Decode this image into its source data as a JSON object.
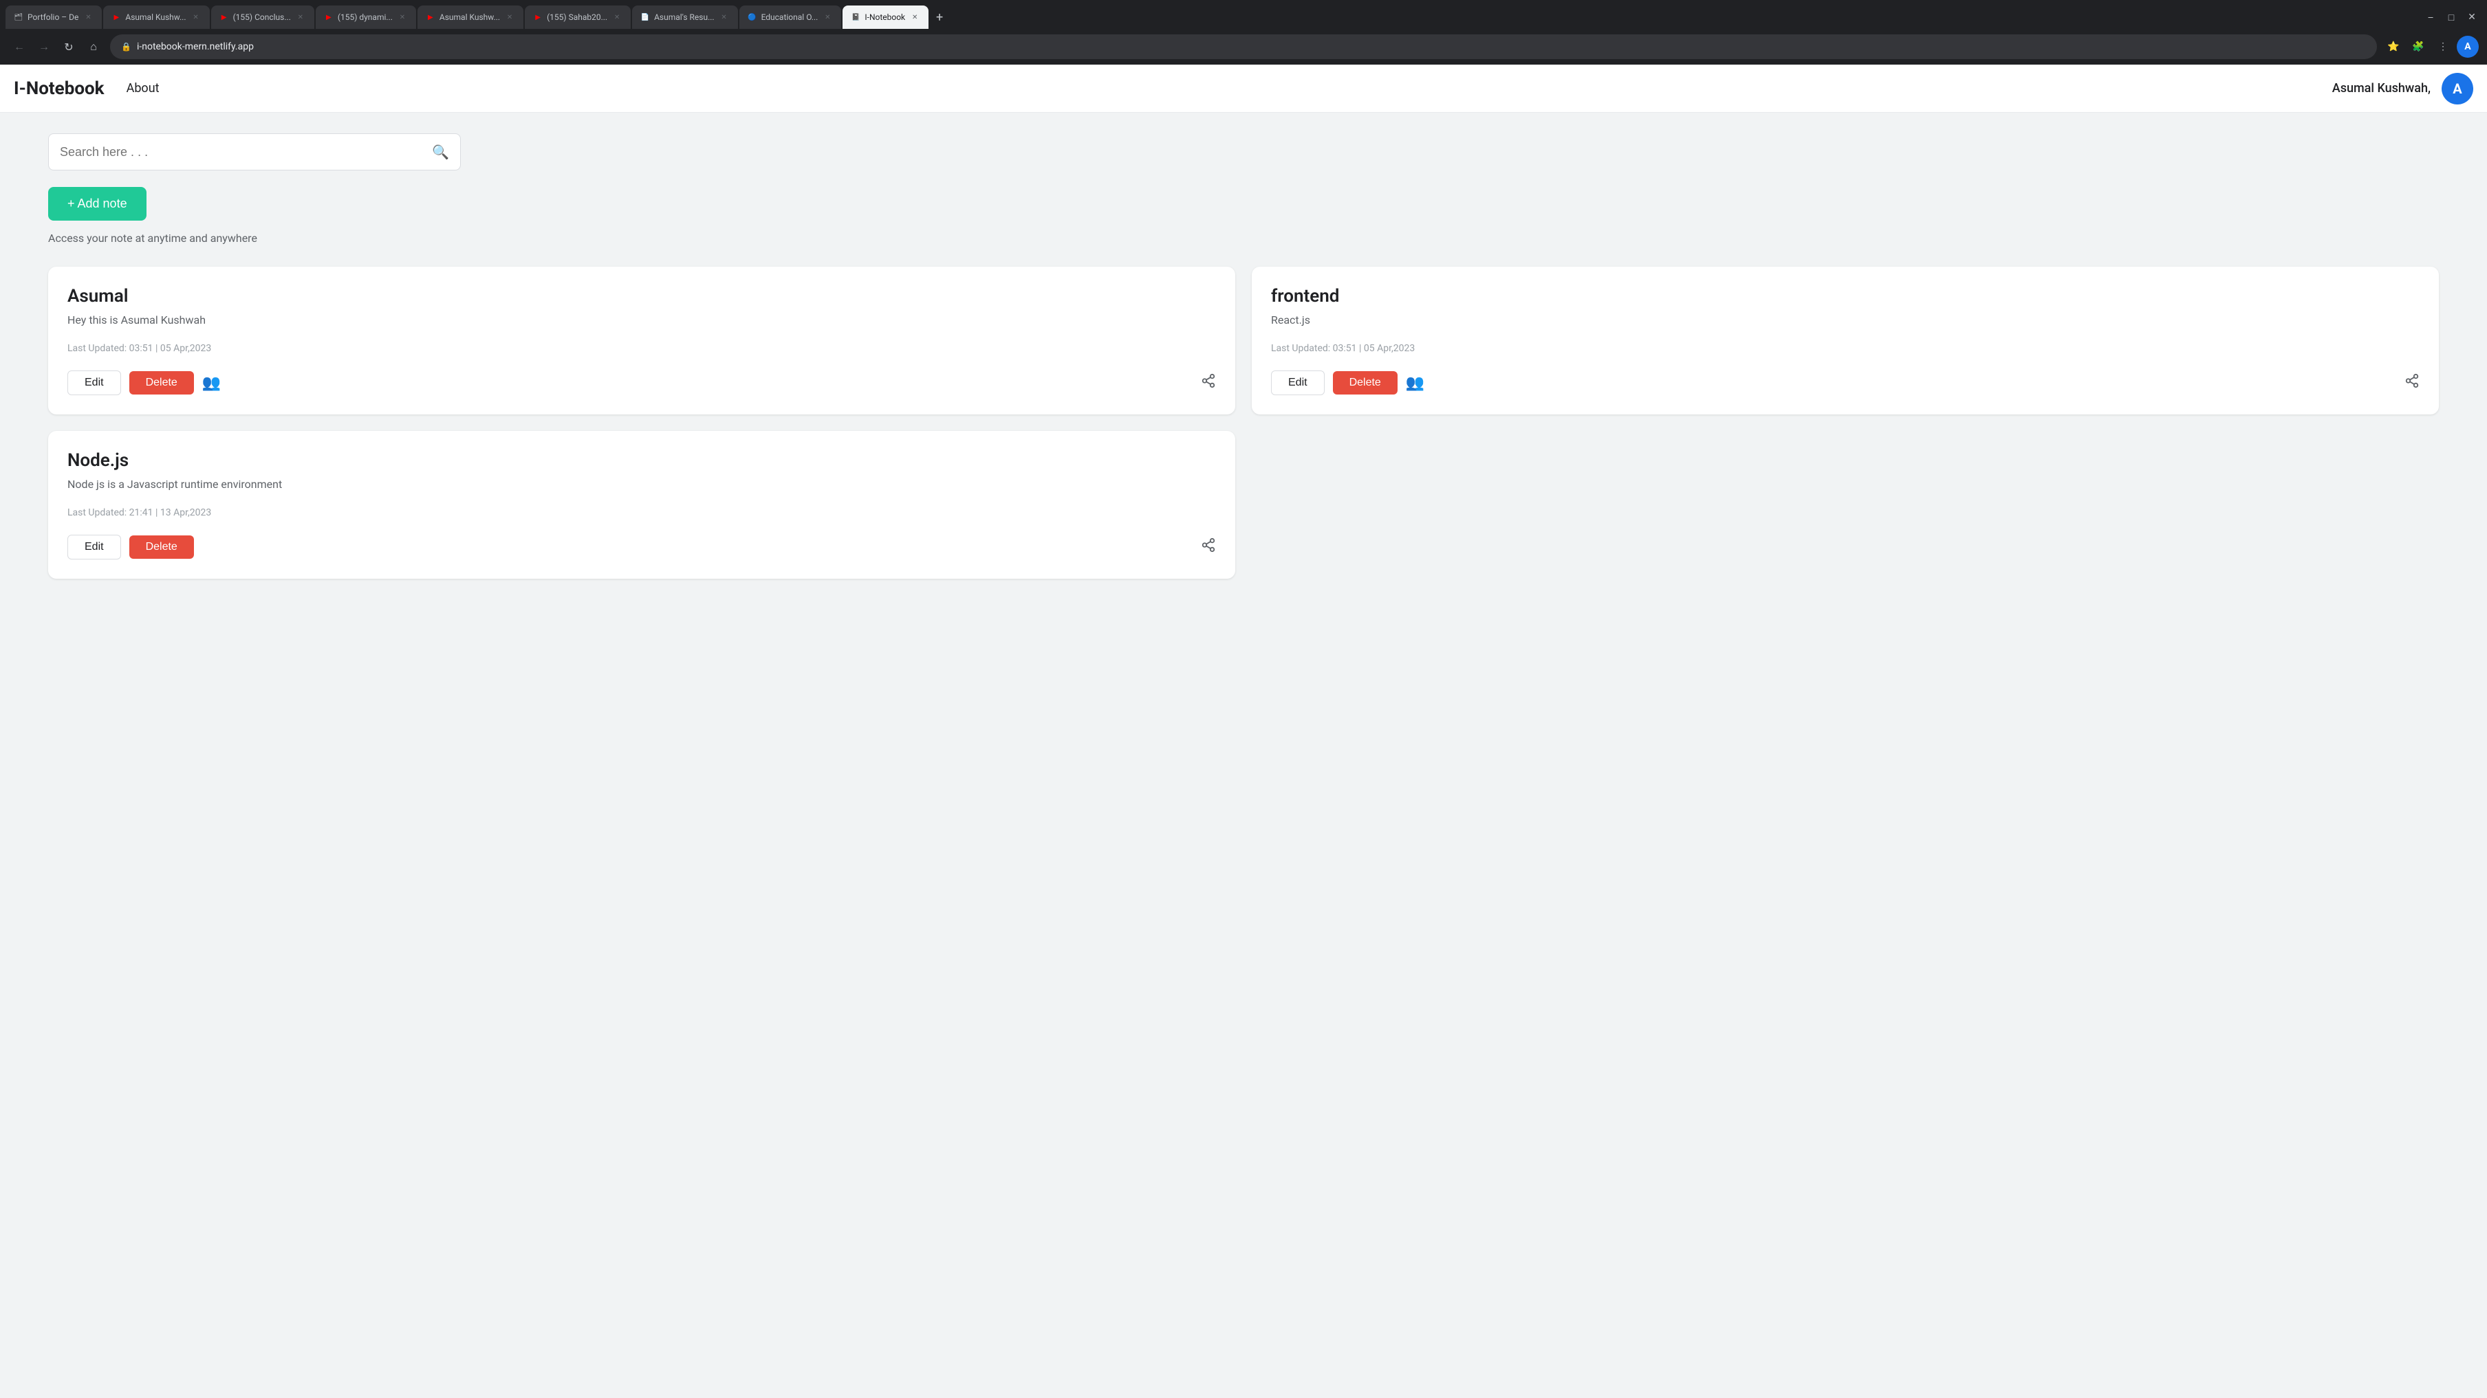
{
  "browser": {
    "address": "i-notebook-mern.netlify.app",
    "tabs": [
      {
        "label": "Portfolio – De",
        "active": false,
        "favicon": "🗂"
      },
      {
        "label": "Asumal Kushw...",
        "active": false,
        "favicon": "▶",
        "favicon_color": "#ff0000"
      },
      {
        "label": "(155) Conclus...",
        "active": false,
        "favicon": "▶",
        "favicon_color": "#ff0000"
      },
      {
        "label": "(155) dynami...",
        "active": false,
        "favicon": "▶",
        "favicon_color": "#ff0000"
      },
      {
        "label": "Asumal Kushw...",
        "active": false,
        "favicon": "▶",
        "favicon_color": "#ff0000"
      },
      {
        "label": "(155) Sahab20...",
        "active": false,
        "favicon": "▶",
        "favicon_color": "#ff0000"
      },
      {
        "label": "Asumal's Resu...",
        "active": false,
        "favicon": "📄"
      },
      {
        "label": "Educational O...",
        "active": false,
        "favicon": "🔵"
      },
      {
        "label": "I-Notebook",
        "active": true,
        "favicon": "📓"
      }
    ]
  },
  "navbar": {
    "brand": "I-Notebook",
    "about_label": "About",
    "user_name": "Asumal Kushwah,",
    "user_initial": "A"
  },
  "search": {
    "placeholder": "Search here . . ."
  },
  "add_note": {
    "label": "+ Add note"
  },
  "tagline": "Access your note at anytime and anywhere",
  "notes": [
    {
      "title": "Asumal",
      "description": "Hey this is Asumal Kushwah",
      "updated": "Last Updated: 03:51 | 05 Apr,2023",
      "edit_label": "Edit",
      "delete_label": "Delete"
    },
    {
      "title": "frontend",
      "description": "React.js",
      "updated": "Last Updated: 03:51 | 05 Apr,2023",
      "edit_label": "Edit",
      "delete_label": "Delete"
    }
  ],
  "notes_row2": [
    {
      "title": "Node.js",
      "description": "Node js is a Javascript runtime environment",
      "updated": "Last Updated: 21:41 | 13 Apr,2023",
      "edit_label": "Edit",
      "delete_label": "Delete"
    }
  ]
}
